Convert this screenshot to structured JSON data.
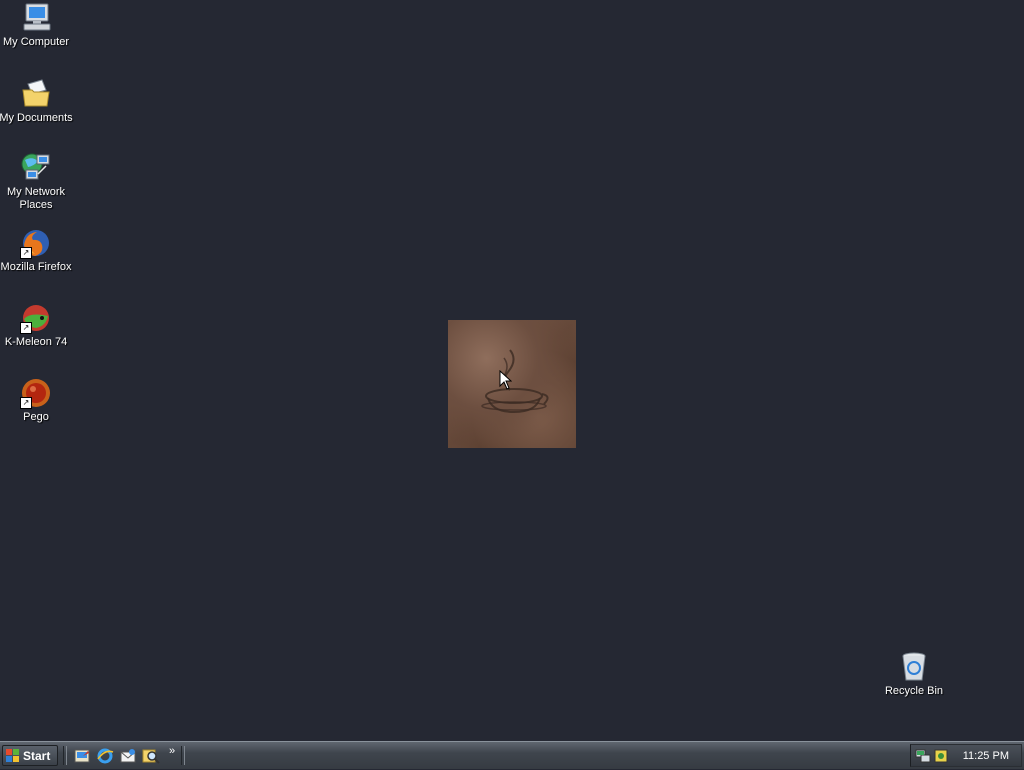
{
  "desktop": {
    "background_color": "#252833",
    "icons": [
      {
        "label": "My Computer",
        "icon": "computer-icon"
      },
      {
        "label": "My Documents",
        "icon": "documents-folder-icon"
      },
      {
        "label": "My Network Places",
        "icon": "network-places-icon"
      },
      {
        "label": "Mozilla Firefox",
        "icon": "firefox-icon"
      },
      {
        "label": "K-Meleon 74",
        "icon": "k-meleon-icon"
      },
      {
        "label": "Pego",
        "icon": "pego-icon"
      }
    ],
    "recycle_bin": {
      "label": "Recycle Bin",
      "icon": "recycle-bin-icon"
    }
  },
  "taskbar": {
    "start_label": "Start",
    "quick_launch": [
      "show-desktop-icon",
      "internet-explorer-icon",
      "outlook-express-icon",
      "search-icon"
    ],
    "more_chevron": "»",
    "tray": {
      "icons": [
        "network-tray-icon",
        "security-tray-icon"
      ],
      "clock": "11:25 PM"
    }
  }
}
